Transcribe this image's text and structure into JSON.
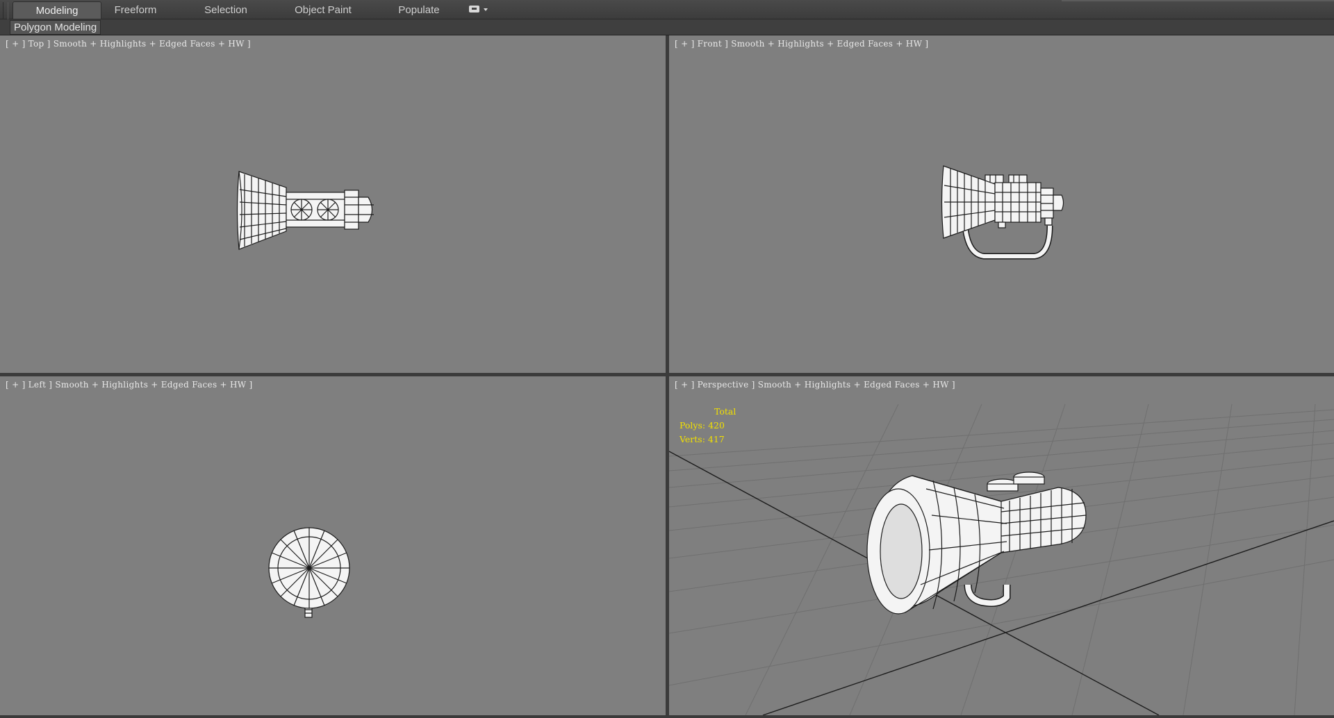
{
  "ribbon": {
    "tabs": [
      {
        "label": "Modeling",
        "active": true
      },
      {
        "label": "Freeform",
        "active": false
      },
      {
        "label": "Selection",
        "active": false
      },
      {
        "label": "Object Paint",
        "active": false
      },
      {
        "label": "Populate",
        "active": false
      }
    ],
    "panel_label": "Polygon Modeling",
    "dropdown_icon": "ribbon-options-icon"
  },
  "viewports": {
    "top": {
      "label": "[ + ] Top ] Smooth + Highlights + Edged Faces + HW ]"
    },
    "front": {
      "label": "[ + ] Front ] Smooth + Highlights + Edged Faces + HW ]"
    },
    "left": {
      "label": "[ + ] Left ] Smooth + Highlights + Edged Faces + HW ]"
    },
    "perspective": {
      "label": "[ + ] Perspective ] Smooth + Highlights + Edged Faces + HW ]"
    }
  },
  "stats": {
    "title": "Total",
    "polys": "Polys: 420",
    "verts": "Verts: 417"
  },
  "colors": {
    "viewport_bg": "#7f7f7f",
    "stats_text": "#f2e000",
    "wire": "#1a1a1a",
    "model_fill": "#f4f4f4"
  }
}
